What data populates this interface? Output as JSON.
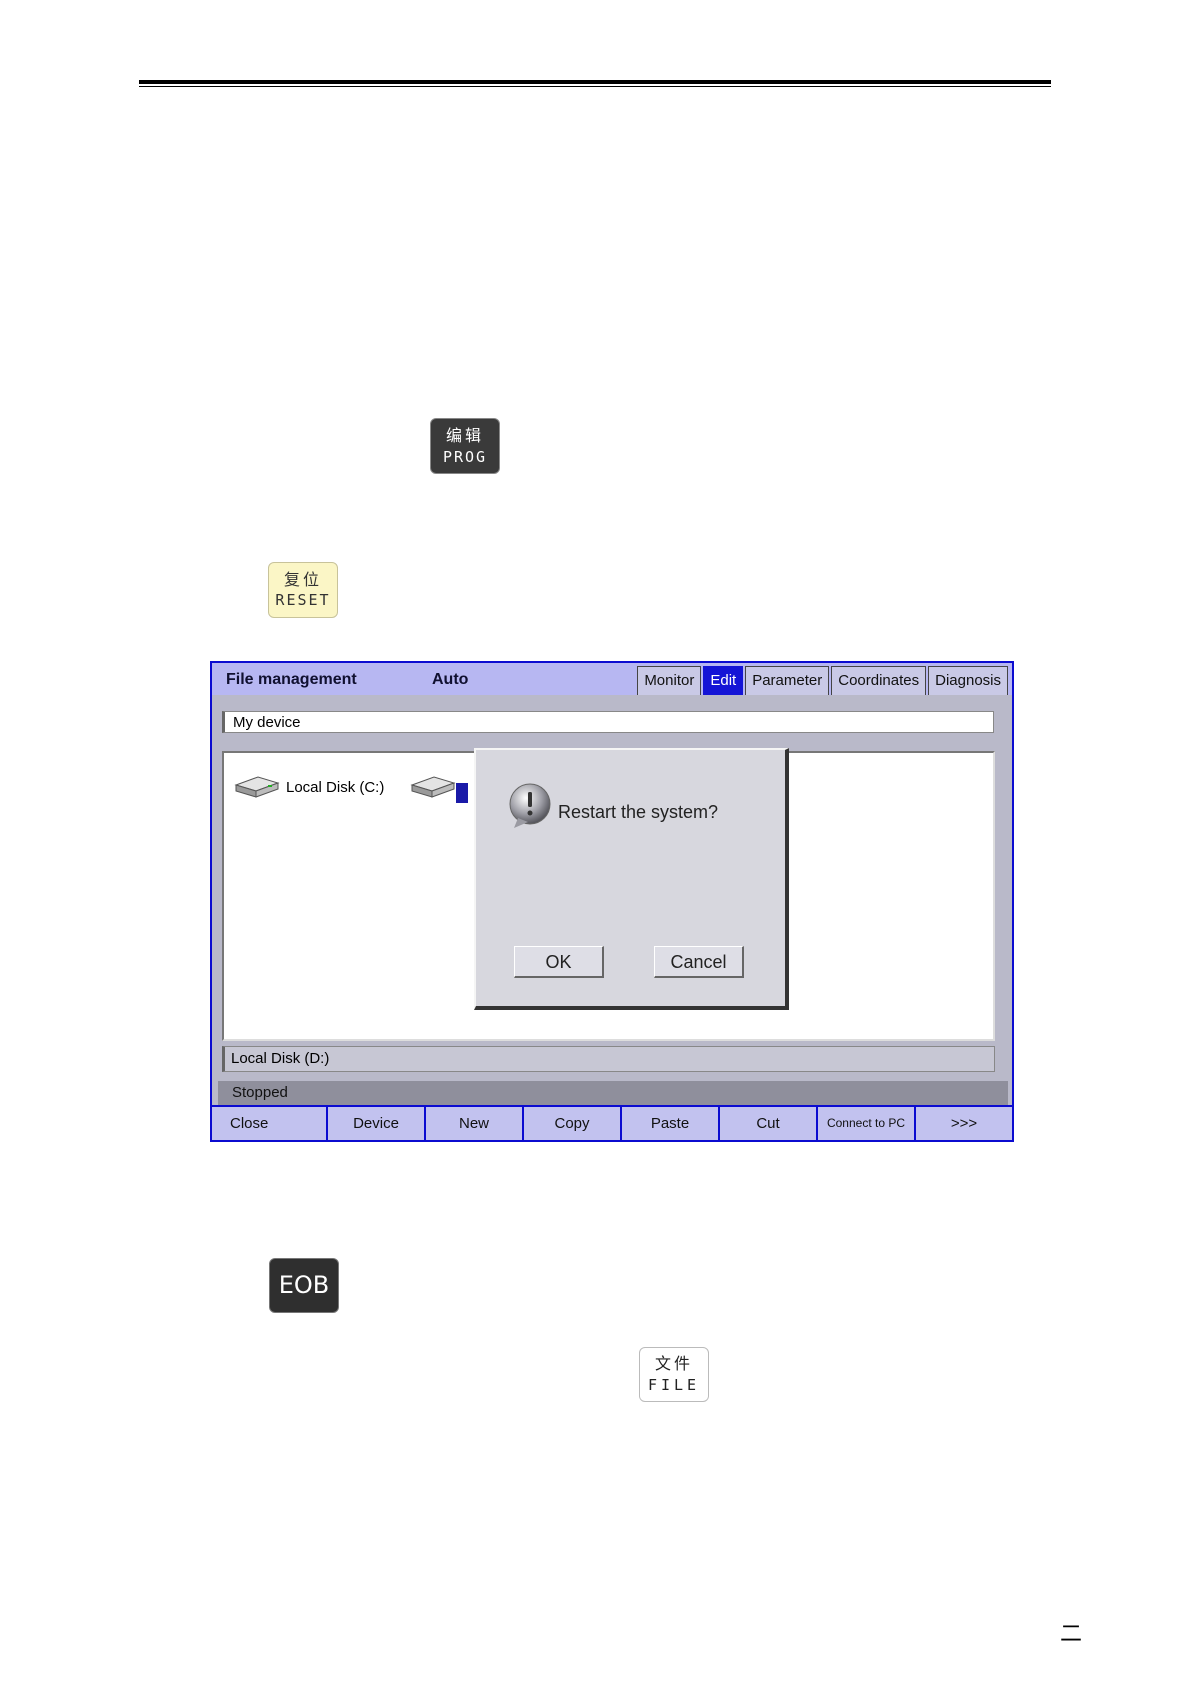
{
  "keys": {
    "prog": {
      "cn": "编辑",
      "en": "PROG"
    },
    "reset": {
      "cn": "复位",
      "en": "RESET"
    },
    "eob": {
      "label": "EOB"
    },
    "file": {
      "cn": "文件",
      "en": "FILE"
    }
  },
  "screen": {
    "title": "File management",
    "mode": "Auto",
    "tabs": [
      {
        "label": "Monitor",
        "active": false
      },
      {
        "label": "Edit",
        "active": true
      },
      {
        "label": "Parameter",
        "active": false
      },
      {
        "label": "Coordinates",
        "active": false
      },
      {
        "label": "Diagnosis",
        "active": false
      }
    ],
    "address": "My device",
    "disks": [
      {
        "label": "Local Disk (C:)"
      }
    ],
    "path": "Local Disk (D:)",
    "status": "Stopped",
    "softkeys": [
      "Close",
      "Device",
      "New",
      "Copy",
      "Paste",
      "Cut",
      "Connect to PC",
      ">>>"
    ]
  },
  "dialog": {
    "message": "Restart the system?",
    "ok_label": "OK",
    "cancel_label": "Cancel"
  },
  "page": {
    "number": "二"
  },
  "colors": {
    "frame": "#0b0bd0",
    "titlebar": "#b7b7f2",
    "softkey": "#c2c2ef",
    "active_tab": "#1414d6"
  }
}
